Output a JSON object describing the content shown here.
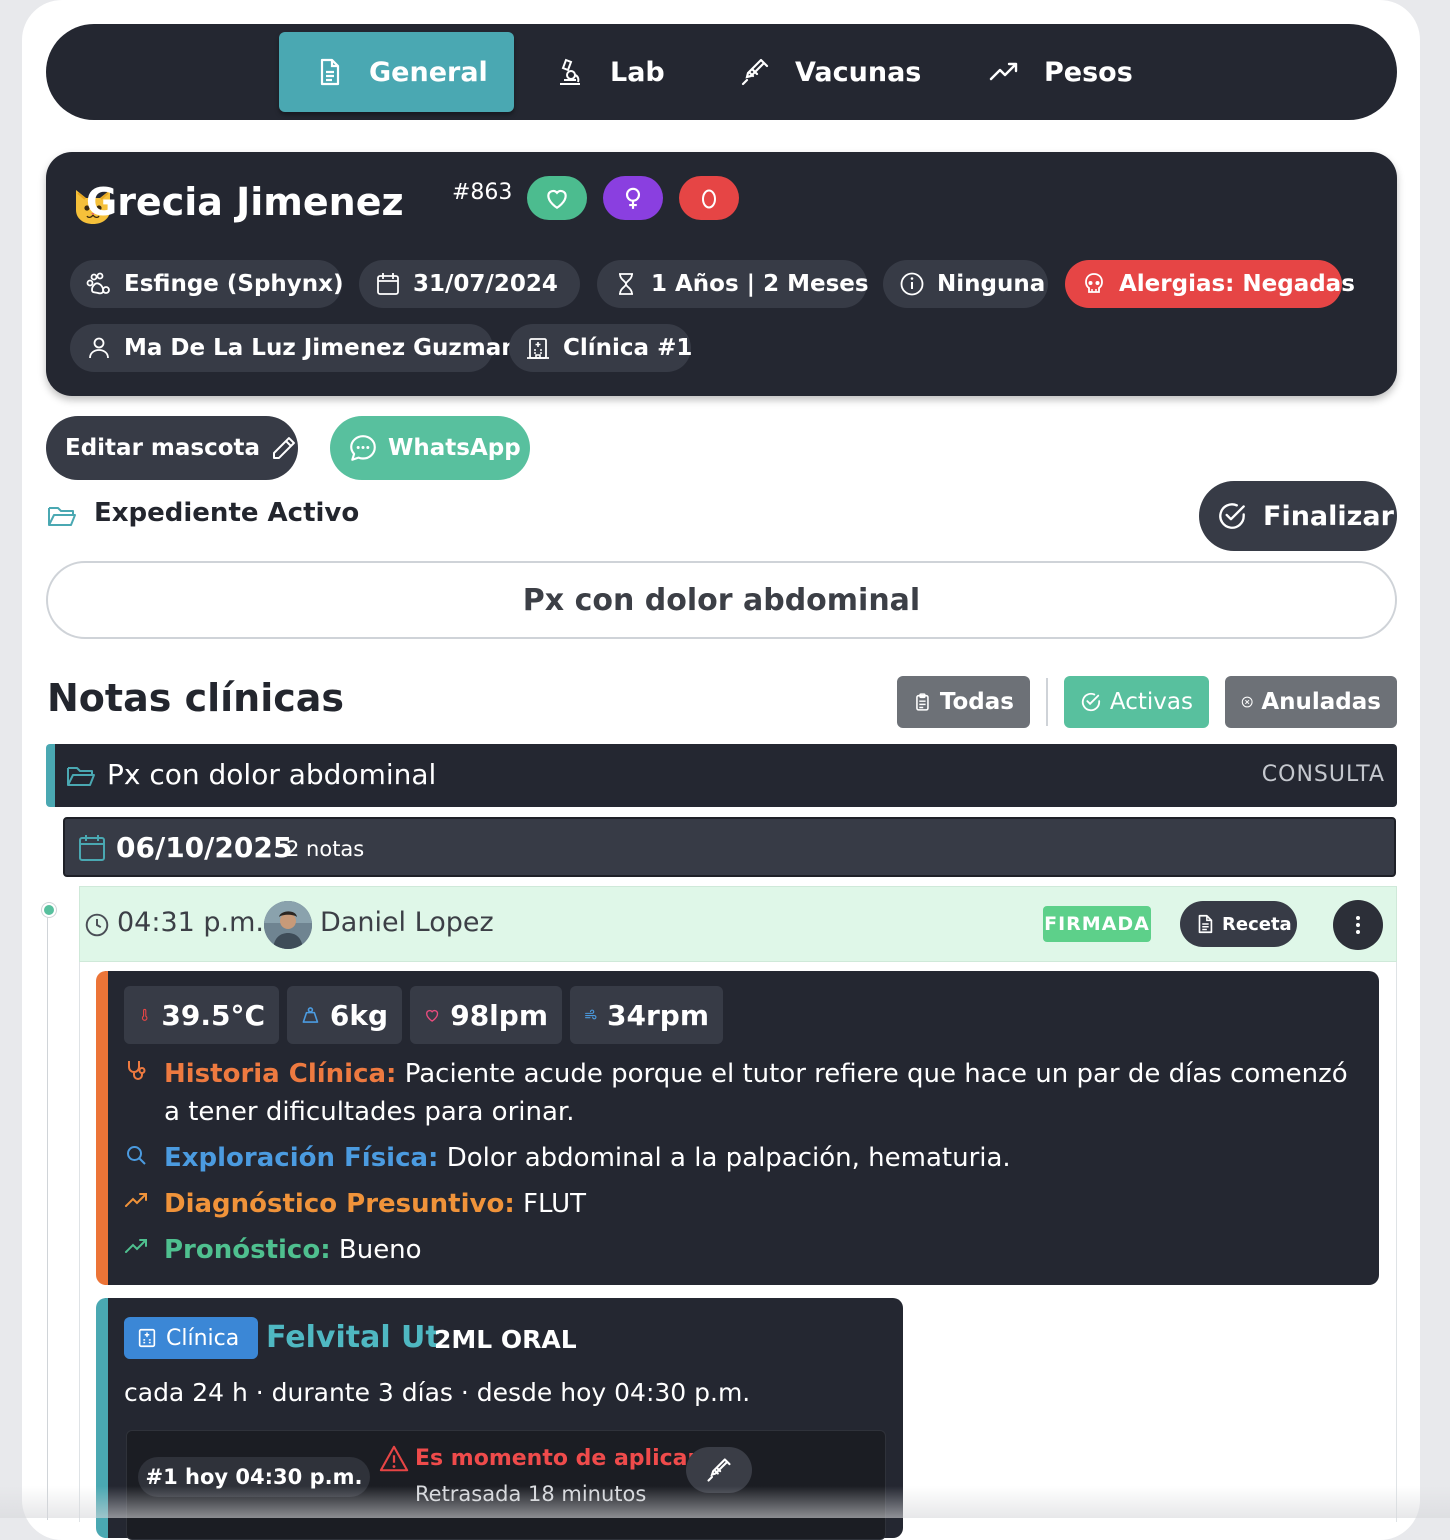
{
  "tabs": [
    {
      "label": "General",
      "icon": "document-icon",
      "active": true
    },
    {
      "label": "Lab",
      "icon": "microscope-icon",
      "active": false
    },
    {
      "label": "Vacunas",
      "icon": "syringe-icon",
      "active": false
    },
    {
      "label": "Pesos",
      "icon": "trending-up-icon",
      "active": false
    }
  ],
  "pet": {
    "avatar_icon": "cat-face-icon",
    "name": "Grecia Jimenez",
    "id": "#863",
    "badges": [
      {
        "icon": "heart-icon",
        "color": "#4cbc8f"
      },
      {
        "icon": "female-icon",
        "color": "#8a3fe0"
      },
      {
        "icon": "blood-drop-icon",
        "color": "#e64545"
      }
    ],
    "breed": "Esfinge (Sphynx)",
    "birthdate": "31/07/2024",
    "age": "1 Años | 2 Meses",
    "condition": "Ninguna",
    "allergies": "Alergias: Negadas",
    "owner": "Ma De La Luz Jimenez Guzman",
    "clinic": "Clínica #1"
  },
  "actions": {
    "edit": "Editar mascota",
    "whatsapp": "WhatsApp",
    "finalize": "Finalizar"
  },
  "record": {
    "status": "Expediente Activo",
    "reason": "Px con dolor abdominal"
  },
  "notes": {
    "title": "Notas clínicas",
    "filters": [
      {
        "label": "Todas",
        "color": "#6d7177"
      },
      {
        "label": "Activas",
        "color": "#58c09e"
      },
      {
        "label": "Anuladas",
        "color": "#6d7177"
      }
    ],
    "folder": {
      "title": "Px con dolor abdominal",
      "type": "CONSULTA"
    },
    "date_group": {
      "date": "06/10/2025",
      "count": "2 notas"
    },
    "note": {
      "time": "04:31 p.m.",
      "author": "Daniel Lopez",
      "status": "FIRMADA",
      "receta": "Receta",
      "vitals": [
        {
          "icon": "thermometer-icon",
          "value": "39.5°C"
        },
        {
          "icon": "weight-icon",
          "value": "6kg"
        },
        {
          "icon": "heart-icon",
          "value": "98lpm"
        },
        {
          "icon": "wind-icon",
          "value": "34rpm"
        }
      ],
      "soap": [
        {
          "label": "Historia Clínica:",
          "text": "Paciente acude porque el tutor refiere que hace un par de días comenzó a tener dificultades para orinar.",
          "color": "#ee7a40"
        },
        {
          "label": "Exploración Física:",
          "text": "Dolor abdominal a la palpación, hematuria.",
          "color": "#4b9be0"
        },
        {
          "label": "Diagnóstico Presuntivo:",
          "text": "FLUT",
          "color": "#f0933a"
        },
        {
          "label": "Pronóstico:",
          "text": "Bueno",
          "color": "#4fc08f"
        }
      ]
    },
    "prescription": {
      "badge": "Clínica",
      "drug": "Felvital Ut",
      "dose": "2ML ORAL",
      "schedule": "cada 24 h · durante 3 días · desde hoy 04:30 p.m.",
      "application": {
        "index": "#1 hoy 04:30 p.m.",
        "alert": "Es momento de aplicar",
        "delay": "Retrasada 18 minutos"
      }
    }
  }
}
